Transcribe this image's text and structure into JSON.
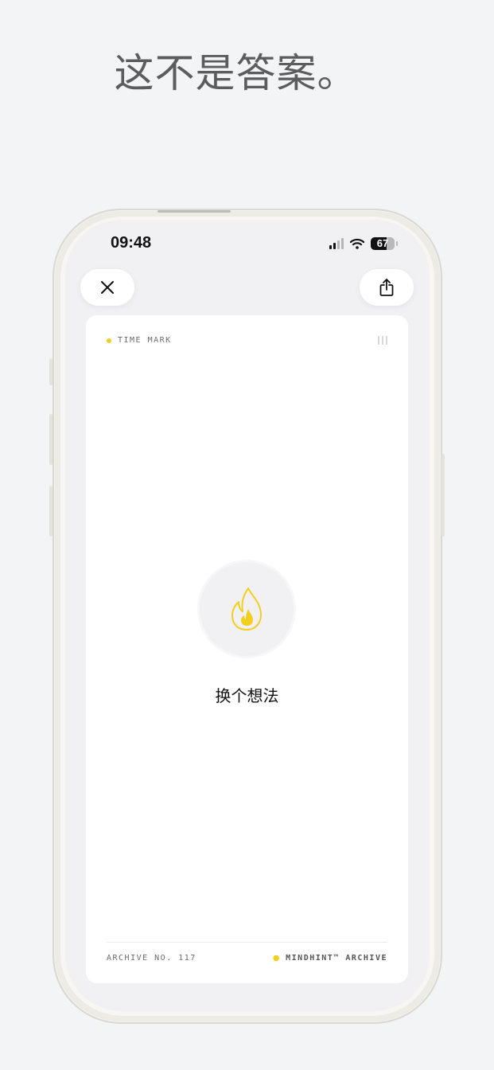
{
  "headline": "这不是答案。",
  "status": {
    "time": "09:48",
    "battery_percent": 67
  },
  "buttons": {
    "close_icon": "close-icon",
    "share_icon": "share-icon"
  },
  "card": {
    "header_label": "TIME MARK",
    "center_text": "换个想法",
    "center_icon": "flame-icon",
    "footer_left": "ARCHIVE NO. 117",
    "footer_right": "MINDHINT™ ARCHIVE"
  },
  "colors": {
    "accent_yellow": "#f2cf1f",
    "text_dark": "#111111",
    "headline_gray": "#5c5c5c"
  }
}
